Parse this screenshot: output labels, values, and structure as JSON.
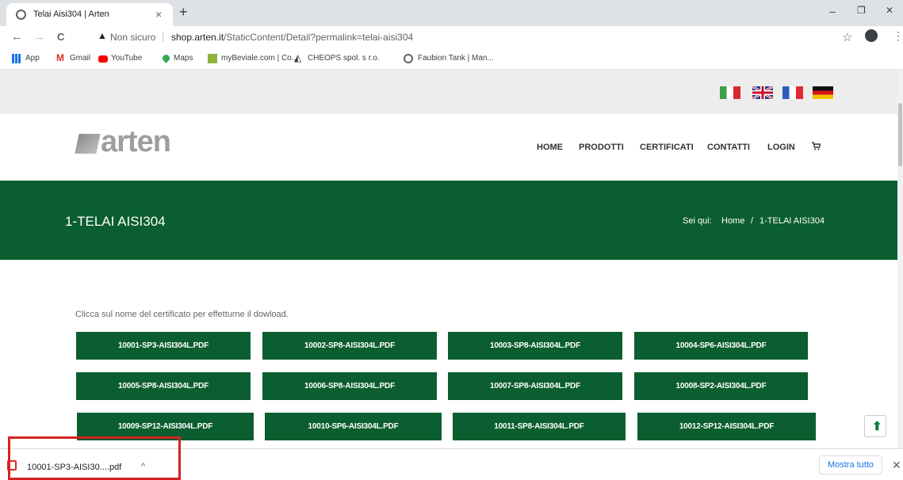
{
  "browser": {
    "tab_title": "Telai Aisi304 | Arten",
    "tab_close": "×",
    "new_tab": "+",
    "win_min": "–",
    "win_max": "❐",
    "win_close": "✕",
    "back": "←",
    "forward": "→",
    "reload": "C",
    "security_icon": "▲",
    "security_text": "Non sicuro",
    "separator": "|",
    "url_host": "shop.arten.it",
    "url_path": "/StaticContent/Detail?permalink=telai-aisi304",
    "star": "☆",
    "kebab": "⋮"
  },
  "bookmarks": [
    {
      "label": "App",
      "icon": "apps-grid-icon"
    },
    {
      "label": "Gmail",
      "icon": "gmail-icon"
    },
    {
      "label": "YouTube",
      "icon": "youtube-icon"
    },
    {
      "label": "Maps",
      "icon": "maps-pin-icon"
    },
    {
      "label": "myBeviale.com | Co...",
      "icon": "mybeviale-icon"
    },
    {
      "label": "CHEOPS spol. s r.o.",
      "icon": "cheops-icon"
    },
    {
      "label": "Faubion Tank | Man...",
      "icon": "globe-icon"
    }
  ],
  "site": {
    "logo_text": "arten",
    "nav": [
      "HOME",
      "PRODOTTI",
      "CERTIFICATI",
      "CONTATTI",
      "LOGIN"
    ],
    "cart_icon": "🛒",
    "hero_title": "1-TELAI AISI304",
    "breadcrumb_label": "Sei qui:",
    "breadcrumb_home": "Home",
    "breadcrumb_sep": "/",
    "breadcrumb_current": "1-TELAI AISI304",
    "intro": "Clicca sul nome del certificato per effetturne il dowload.",
    "files": [
      "10001-SP3-AISI304L.PDF",
      "10002-SP8-AISI304L.PDF",
      "10003-SP8-AISI304L.PDF",
      "10004-SP6-AISI304L.PDF",
      "10005-SP8-AISI304L.PDF",
      "10006-SP8-AISI304L.PDF",
      "10007-SP8-AISI304L.PDF",
      "10008-SP2-AISI304L.PDF",
      "10009-SP12-AISI304L.PDF",
      "10010-SP6-AISI304L.PDF",
      "10011-SP8-AISI304L.PDF",
      "10012-SP12-AISI304L.PDF"
    ],
    "scroll_top_icon": "⬆"
  },
  "downloads": {
    "file_name": "10001-SP3-AISI30....pdf",
    "caret": "^",
    "show_all": "Mostra tutto",
    "close": "✕"
  },
  "colors": {
    "brand_green": "#0b5e2f",
    "highlight_red": "#d42222"
  }
}
